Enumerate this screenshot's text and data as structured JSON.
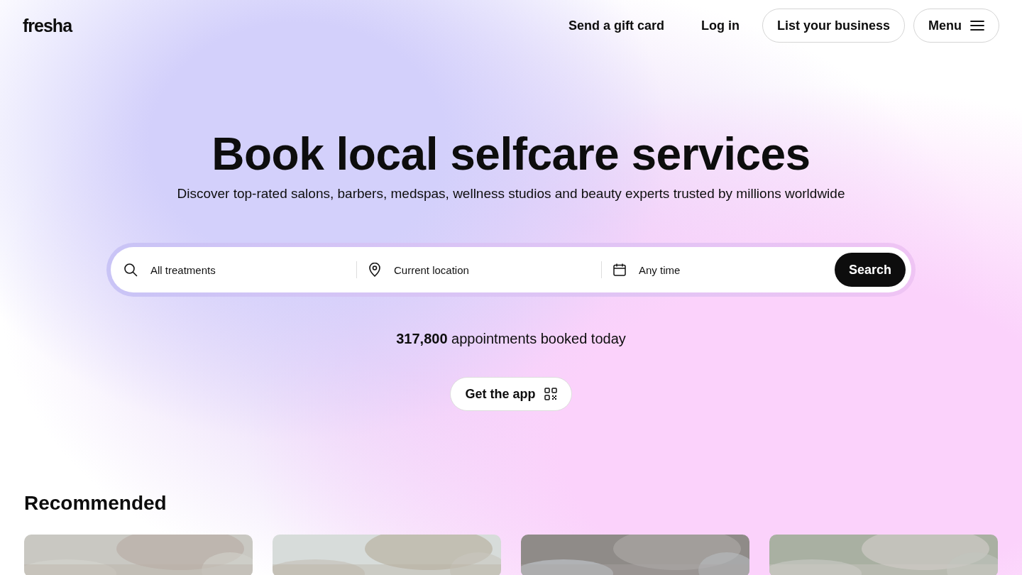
{
  "header": {
    "logo": "fresha",
    "links": [
      "Send a gift card",
      "Log in"
    ],
    "buttons": [
      "List your business",
      "Menu"
    ]
  },
  "hero": {
    "title": "Book local selfcare services",
    "subtitle": "Discover top-rated salons, barbers, medspas, wellness studios and beauty experts trusted by millions worldwide"
  },
  "search": {
    "fields": [
      {
        "kind": "treatment",
        "placeholder": "All treatments"
      },
      {
        "kind": "location",
        "placeholder": "Current location"
      },
      {
        "kind": "time",
        "placeholder": "Any time"
      }
    ],
    "button": "Search"
  },
  "stats": {
    "count": "317,800",
    "text": "appointments booked today"
  },
  "app_button": "Get the app",
  "recommended": {
    "title": "Recommended"
  }
}
